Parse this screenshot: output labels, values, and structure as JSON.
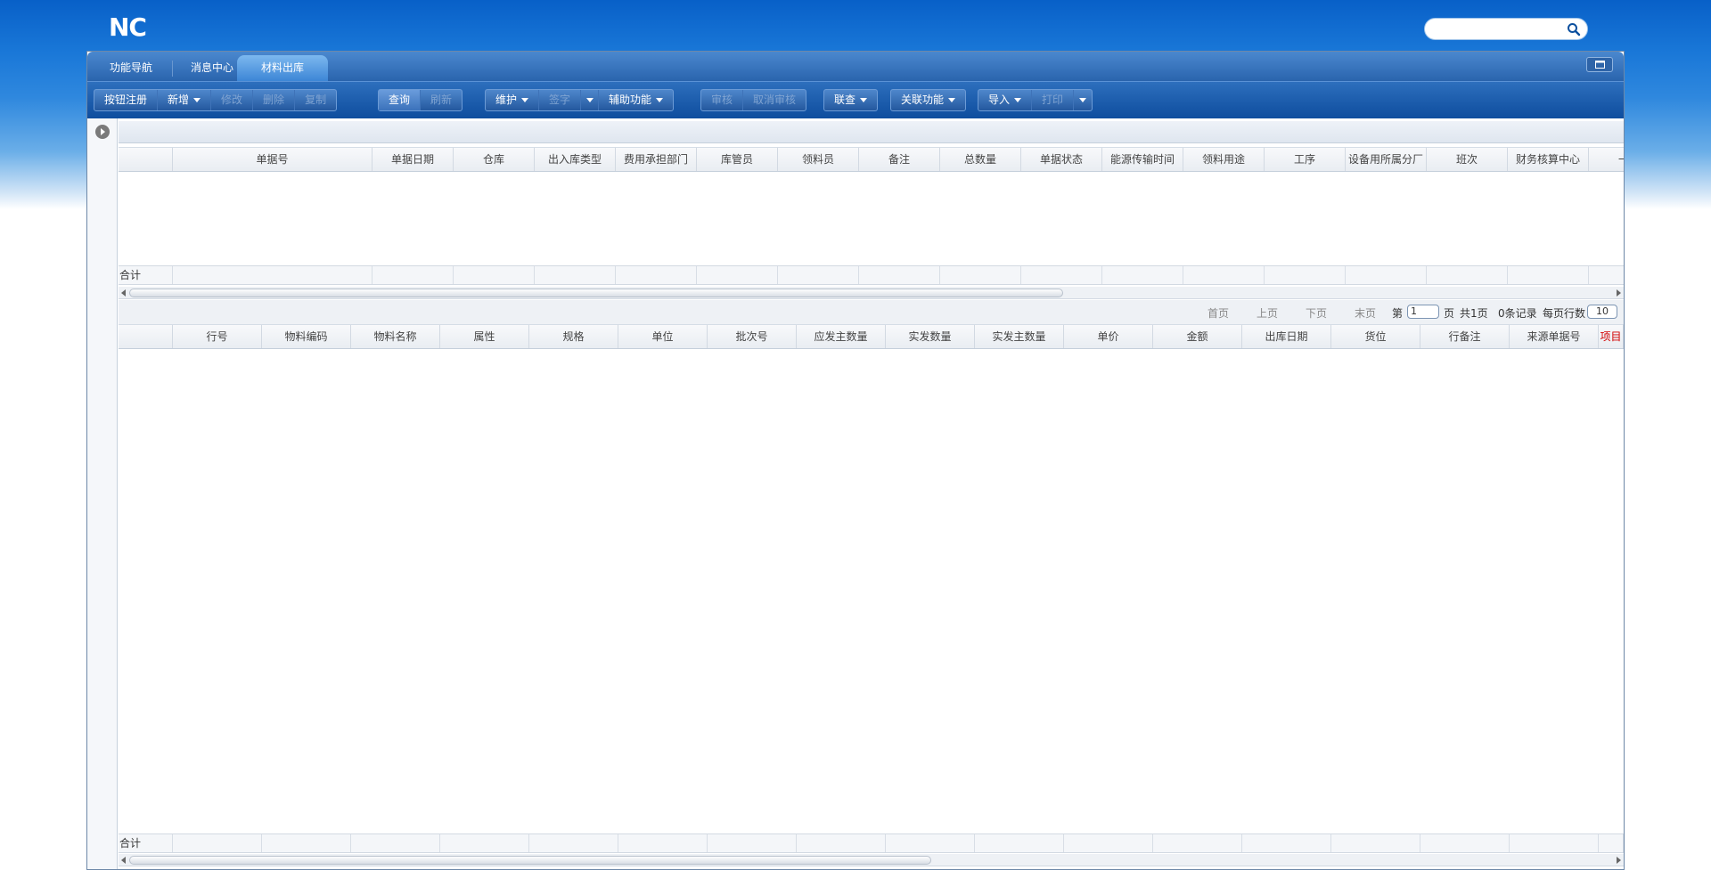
{
  "app": {
    "logo": "NC"
  },
  "search": {
    "placeholder": "",
    "value": ""
  },
  "tabs": [
    {
      "label": "功能导航"
    },
    {
      "label": "消息中心"
    },
    {
      "label": "材料出库",
      "active": true
    }
  ],
  "toolbar": {
    "register": "按钮注册",
    "add": "新增",
    "edit": "修改",
    "delete": "删除",
    "copy": "复制",
    "query": "查询",
    "refresh": "刷新",
    "maintain": "维护",
    "sign": "签字",
    "assist": "辅助功能",
    "audit": "审核",
    "cancel_audit": "取消审核",
    "link_query": "联查",
    "related": "关联功能",
    "import": "导入",
    "print": "打印"
  },
  "header_grid": {
    "columns": [
      "",
      "单据号",
      "单据日期",
      "仓库",
      "出入库类型",
      "费用承担部门",
      "库管员",
      "领料员",
      "备注",
      "总数量",
      "单据状态",
      "能源传输时间",
      "领料用途",
      "工序",
      "设备用所属分厂",
      "班次",
      "财务核算中心",
      "一级"
    ],
    "rows": [],
    "sum_label": "合计"
  },
  "pager": {
    "first": "首页",
    "prev": "上页",
    "next": "下页",
    "last": "末页",
    "page_prefix": "第",
    "page_value": "1",
    "page_suffix": "页",
    "total_pages": "共1页",
    "records": "0条记录",
    "rows_per_page_label": "每页行数",
    "rows_per_page": "10"
  },
  "body_grid": {
    "columns": [
      "",
      "行号",
      "物料编码",
      "物料名称",
      "属性",
      "规格",
      "单位",
      "批次号",
      "应发主数量",
      "实发数量",
      "实发主数量",
      "单价",
      "金额",
      "出库日期",
      "货位",
      "行备注",
      "来源单据号",
      "项目"
    ],
    "rows": [],
    "sum_label": "合计"
  },
  "colors": {
    "brand": "#0860c8",
    "toolbar": "#1a5aa8",
    "required": "#d20000"
  }
}
